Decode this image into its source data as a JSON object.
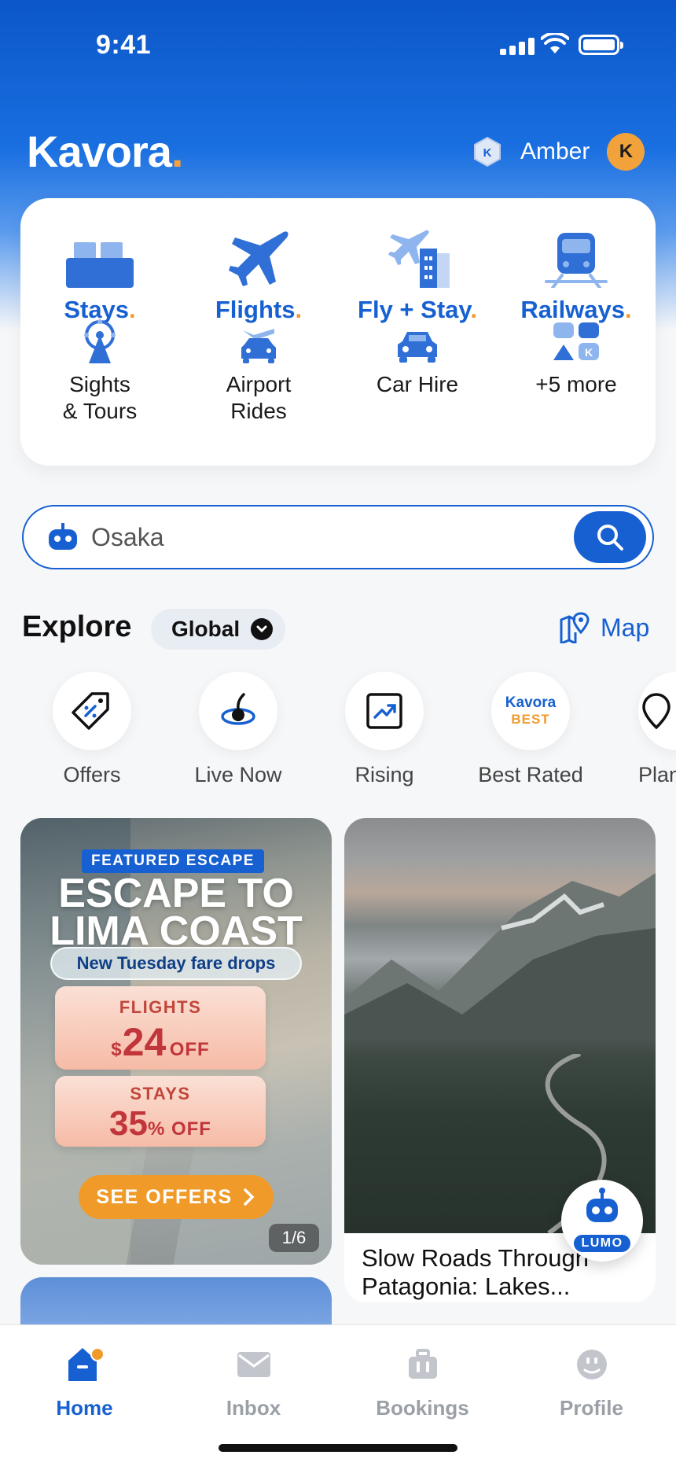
{
  "status_bar": {
    "time": "9:41"
  },
  "header": {
    "logo": "Kavora",
    "logo_dot": ".",
    "member_badge": "K",
    "user_name": "Amber",
    "avatar_initial": "K"
  },
  "categories": [
    {
      "label": "Stays",
      "dot": ".",
      "icon": "bed-icon"
    },
    {
      "label": "Flights",
      "dot": ".",
      "icon": "plane-icon"
    },
    {
      "label": "Fly + Stay",
      "dot": ".",
      "icon": "plane-hotel-icon"
    },
    {
      "label": "Railways",
      "dot": ".",
      "icon": "train-icon"
    },
    {
      "label_line1": "Sights",
      "label_line2": "& Tours",
      "icon": "ferris-wheel-icon"
    },
    {
      "label_line1": "Airport",
      "label_line2": "Rides",
      "icon": "airport-car-icon"
    },
    {
      "label_line1": "Car Hire",
      "label_line2": "",
      "icon": "car-icon"
    },
    {
      "label_line1": "+5 more",
      "label_line2": "",
      "icon": "more-grid-icon",
      "icon_badge": "K"
    }
  ],
  "search": {
    "value": "Osaka",
    "placeholder": "Osaka"
  },
  "explore": {
    "title": "Explore",
    "region": "Global",
    "map_label": "Map",
    "chips": [
      {
        "label": "Offers",
        "icon": "tag-icon"
      },
      {
        "label": "Live Now",
        "icon": "live-icon"
      },
      {
        "label": "Rising",
        "icon": "trend-icon"
      },
      {
        "label": "Best Rated",
        "icon": "kavora-best-icon",
        "badge_top": "Kavora",
        "badge_bottom": "BEST"
      },
      {
        "label": "Plan",
        "icon": "location-pin-icon"
      }
    ]
  },
  "promo": {
    "badge": "FEATURED ESCAPE",
    "title_line1": "ESCAPE TO",
    "title_line2": "LIMA COAST",
    "subtitle": "New Tuesday fare drops",
    "offer1_kind": "FLIGHTS",
    "offer1_currency": "$",
    "offer1_amount": "24",
    "offer1_suffix": "OFF",
    "offer2_kind": "STAYS",
    "offer2_amount": "35",
    "offer2_suffix": "% OFF",
    "cta": "SEE OFFERS",
    "pager": "1/6"
  },
  "article": {
    "title": "Slow Roads Through Patagonia: Lakes..."
  },
  "lumo": {
    "label": "LUMO"
  },
  "tabs": [
    {
      "label": "Home",
      "icon": "home-icon",
      "active": true
    },
    {
      "label": "Inbox",
      "icon": "mail-icon",
      "active": false
    },
    {
      "label": "Bookings",
      "icon": "briefcase-icon",
      "active": false
    },
    {
      "label": "Profile",
      "icon": "profile-icon",
      "active": false
    }
  ],
  "colors": {
    "brand_blue": "#1760d1",
    "accent_orange": "#f09a2a",
    "hero_blue": "#0b57c9"
  }
}
